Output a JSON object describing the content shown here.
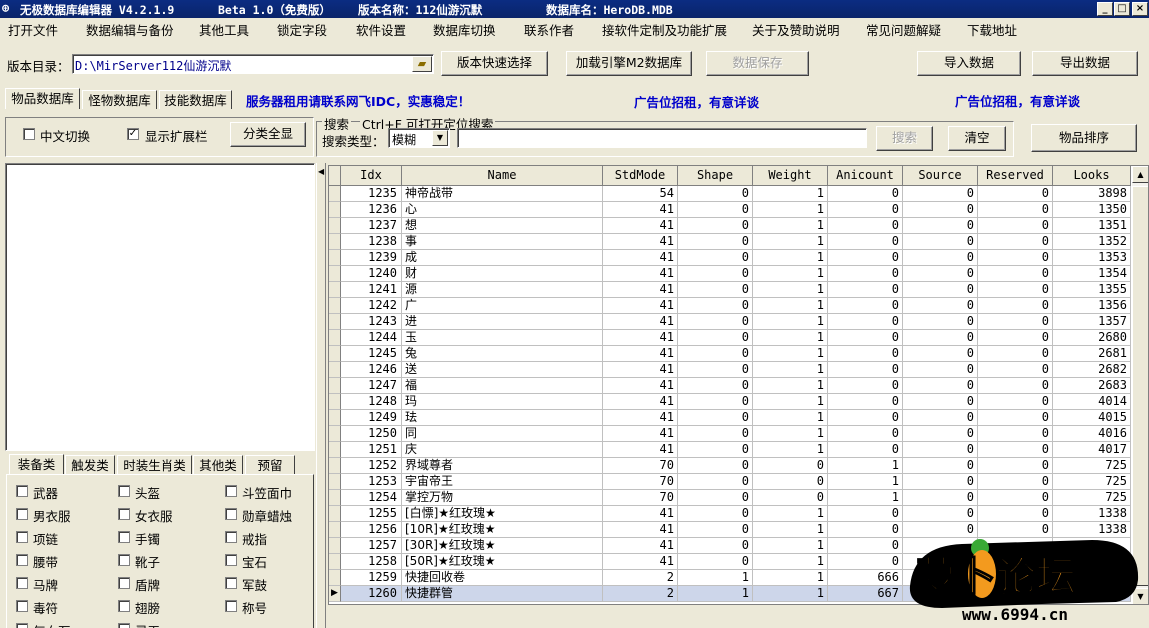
{
  "window": {
    "app_title": "无极数据库编辑器 V4.2.1.9",
    "beta": "Beta 1.0（免费版）",
    "version_name": "版本名称：112仙游沉默",
    "db_name": "数据库名：HeroDB.MDB",
    "min": "_",
    "max": "□",
    "close": "×"
  },
  "menu": [
    "打开文件",
    "数据编辑与备份",
    "其他工具",
    "锁定字段",
    "软件设置",
    "数据库切换",
    "联系作者",
    "接软件定制及功能扩展",
    "关于及赞助说明",
    "常见问题解疑",
    "下载地址"
  ],
  "toolbar": {
    "dir_label": "版本目录：",
    "dir_value": "D:\\MirServer112仙游沉默",
    "quick_select": "版本快速选择",
    "load_m2": "加载引擎M2数据库",
    "save": "数据保存",
    "import": "导入数据",
    "export": "导出数据"
  },
  "tabs": [
    "物品数据库",
    "怪物数据库",
    "技能数据库"
  ],
  "ads": [
    "服务器租用请联系网飞IDC，实惠稳定！",
    "广告位招租，有意详谈",
    "广告位招租，有意详谈"
  ],
  "options": {
    "chinese_switch": "中文切换",
    "show_ext": "显示扩展栏",
    "show_ext_checked": "✓",
    "show_all": "分类全显"
  },
  "search": {
    "group_label": "搜索",
    "hint": "Ctrl+F 可打开定位搜索",
    "type_label": "搜索类型：",
    "type_value": "模糊",
    "search_btn": "搜索",
    "clear_btn": "清空",
    "sort_btn": "物品排序"
  },
  "cat_tabs": [
    "装备类",
    "触发类",
    "时装生肖类",
    "其他类",
    "预留"
  ],
  "categories": [
    [
      "武器",
      "头盔",
      "斗笠面巾"
    ],
    [
      "男衣服",
      "女衣服",
      "勋章蜡烛"
    ],
    [
      "项链",
      "手镯",
      "戒指"
    ],
    [
      "腰带",
      "靴子",
      "宝石"
    ],
    [
      "马牌",
      "盾牌",
      "军鼓"
    ],
    [
      "毒符",
      "翅膀",
      "称号"
    ],
    [
      "气血石",
      "灵玉",
      ""
    ]
  ],
  "grid": {
    "columns": [
      "Idx",
      "Name",
      "StdMode",
      "Shape",
      "Weight",
      "Anicount",
      "Source",
      "Reserved",
      "Looks"
    ],
    "rows": [
      [
        "1235",
        "神帝战带",
        "54",
        "0",
        "1",
        "0",
        "0",
        "0",
        "3898"
      ],
      [
        "1236",
        "心",
        "41",
        "0",
        "1",
        "0",
        "0",
        "0",
        "1350"
      ],
      [
        "1237",
        "想",
        "41",
        "0",
        "1",
        "0",
        "0",
        "0",
        "1351"
      ],
      [
        "1238",
        "事",
        "41",
        "0",
        "1",
        "0",
        "0",
        "0",
        "1352"
      ],
      [
        "1239",
        "成",
        "41",
        "0",
        "1",
        "0",
        "0",
        "0",
        "1353"
      ],
      [
        "1240",
        "财",
        "41",
        "0",
        "1",
        "0",
        "0",
        "0",
        "1354"
      ],
      [
        "1241",
        "源",
        "41",
        "0",
        "1",
        "0",
        "0",
        "0",
        "1355"
      ],
      [
        "1242",
        "广",
        "41",
        "0",
        "1",
        "0",
        "0",
        "0",
        "1356"
      ],
      [
        "1243",
        "进",
        "41",
        "0",
        "1",
        "0",
        "0",
        "0",
        "1357"
      ],
      [
        "1244",
        "玉",
        "41",
        "0",
        "1",
        "0",
        "0",
        "0",
        "2680"
      ],
      [
        "1245",
        "兔",
        "41",
        "0",
        "1",
        "0",
        "0",
        "0",
        "2681"
      ],
      [
        "1246",
        "送",
        "41",
        "0",
        "1",
        "0",
        "0",
        "0",
        "2682"
      ],
      [
        "1247",
        "福",
        "41",
        "0",
        "1",
        "0",
        "0",
        "0",
        "2683"
      ],
      [
        "1248",
        "玛",
        "41",
        "0",
        "1",
        "0",
        "0",
        "0",
        "4014"
      ],
      [
        "1249",
        "珐",
        "41",
        "0",
        "1",
        "0",
        "0",
        "0",
        "4015"
      ],
      [
        "1250",
        "同",
        "41",
        "0",
        "1",
        "0",
        "0",
        "0",
        "4016"
      ],
      [
        "1251",
        "庆",
        "41",
        "0",
        "1",
        "0",
        "0",
        "0",
        "4017"
      ],
      [
        "1252",
        "界域尊者",
        "70",
        "0",
        "0",
        "1",
        "0",
        "0",
        "725"
      ],
      [
        "1253",
        "宇宙帝王",
        "70",
        "0",
        "0",
        "1",
        "0",
        "0",
        "725"
      ],
      [
        "1254",
        "掌控万物",
        "70",
        "0",
        "0",
        "1",
        "0",
        "0",
        "725"
      ],
      [
        "1255",
        "[白慓]★红玫瑰★",
        "41",
        "0",
        "1",
        "0",
        "0",
        "0",
        "1338"
      ],
      [
        "1256",
        "[10R]★红玫瑰★",
        "41",
        "0",
        "1",
        "0",
        "0",
        "0",
        "1338"
      ],
      [
        "1257",
        "[30R]★红玫瑰★",
        "41",
        "0",
        "1",
        "0",
        "",
        "",
        ""
      ],
      [
        "1258",
        "[50R]★红玫瑰★",
        "41",
        "0",
        "1",
        "0",
        "",
        "",
        ""
      ],
      [
        "1259",
        "快捷回收卷",
        "2",
        "1",
        "1",
        "666",
        "",
        "",
        ""
      ],
      [
        "1260",
        "快捷群管",
        "2",
        "1",
        "1",
        "667",
        "",
        "",
        ""
      ]
    ],
    "selected_index": 25
  },
  "watermark": {
    "logo_text": "萝卜论坛",
    "url": "www.6994.cn"
  },
  "colors": {
    "title_bar": "#0a246a",
    "face": "#ece9d8",
    "selected_row": "#cdd6ea",
    "ad_text": "#0000cc",
    "logo_orange": "#f39a1e"
  }
}
